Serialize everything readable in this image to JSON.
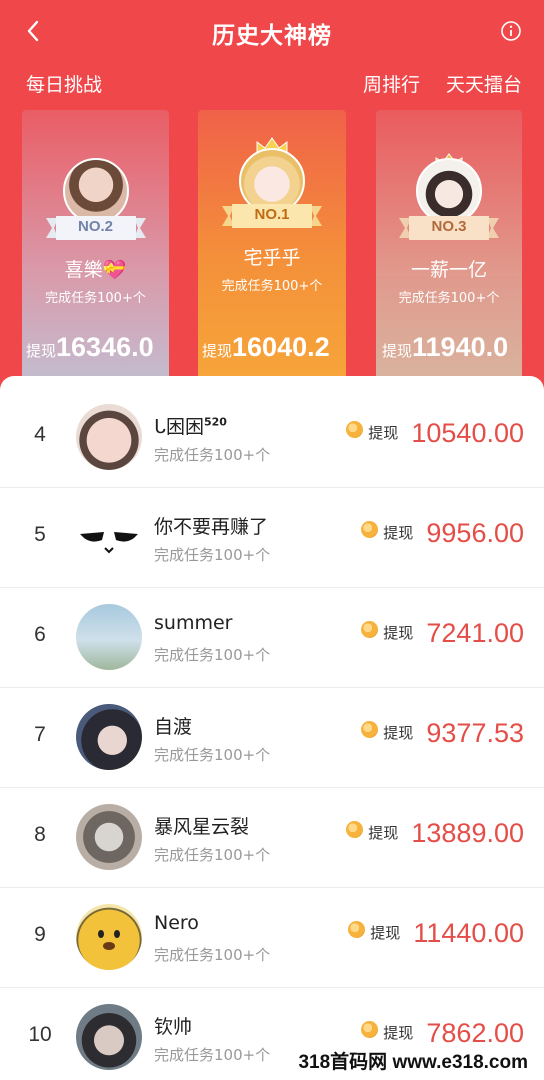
{
  "header": {
    "title": "历史大神榜",
    "back_icon": "back-arrow-icon",
    "info_icon": "info-icon"
  },
  "tabs": {
    "daily": "每日挑战",
    "weekly": "周排行",
    "arena": "天天擂台"
  },
  "podium": [
    {
      "rank_label": "NO.2",
      "name": "喜樂💝",
      "task": "完成任务100+个",
      "withdraw_label": "提现",
      "amount": "16346.0"
    },
    {
      "rank_label": "NO.1",
      "name": "宅乎乎",
      "task": "完成任务100+个",
      "withdraw_label": "提现",
      "amount": "16040.2"
    },
    {
      "rank_label": "NO.3",
      "name": "一薪一亿",
      "task": "完成任务100+个",
      "withdraw_label": "提现",
      "amount": "11940.0"
    }
  ],
  "ranking": [
    {
      "rank": "4",
      "name": "ᒐ困困",
      "name_sup": "520",
      "task": "完成任务100+个",
      "withdraw_label": "提现",
      "amount": "10540.00"
    },
    {
      "rank": "5",
      "name": "你不要再赚了",
      "name_sup": "",
      "task": "完成任务100+个",
      "withdraw_label": "提现",
      "amount": "9956.00"
    },
    {
      "rank": "6",
      "name": "summer",
      "name_sup": "",
      "task": "完成任务100+个",
      "withdraw_label": "提现",
      "amount": "7241.00"
    },
    {
      "rank": "7",
      "name": "自渡",
      "name_sup": "",
      "task": "完成任务100+个",
      "withdraw_label": "提现",
      "amount": "9377.53"
    },
    {
      "rank": "8",
      "name": "暴风星云裂",
      "name_sup": "",
      "task": "完成任务100+个",
      "withdraw_label": "提现",
      "amount": "13889.00"
    },
    {
      "rank": "9",
      "name": "Nero",
      "name_sup": "",
      "task": "完成任务100+个",
      "withdraw_label": "提现",
      "amount": "11440.00"
    },
    {
      "rank": "10",
      "name": "钦帅",
      "name_sup": "",
      "task": "完成任务100+个",
      "withdraw_label": "提现",
      "amount": "7862.00"
    }
  ],
  "watermark": "318首码网 www.e318.com",
  "colors": {
    "header_bg": "#f0474a",
    "amount": "#e44e48",
    "coin": "#f6b23c"
  }
}
